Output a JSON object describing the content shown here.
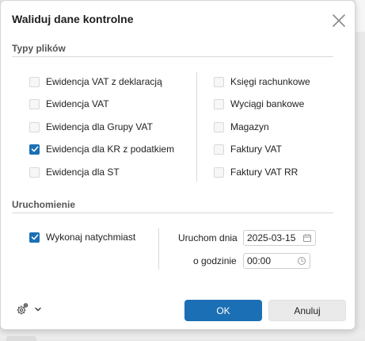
{
  "dialog": {
    "title": "Waliduj dane kontrolne",
    "close_icon": "close-icon"
  },
  "file_types": {
    "section_label": "Typy plików",
    "left": [
      {
        "label": "Ewidencja VAT z deklaracją",
        "checked": false
      },
      {
        "label": "Ewidencja VAT",
        "checked": false
      },
      {
        "label": "Ewidencja dla Grupy VAT",
        "checked": false
      },
      {
        "label": "Ewidencja dla KR z podatkiem",
        "checked": true
      },
      {
        "label": "Ewidencja dla ST",
        "checked": false
      }
    ],
    "right": [
      {
        "label": "Księgi rachunkowe",
        "checked": false
      },
      {
        "label": "Wyciągi bankowe",
        "checked": false
      },
      {
        "label": "Magazyn",
        "checked": false
      },
      {
        "label": "Faktury VAT",
        "checked": false
      },
      {
        "label": "Faktury VAT RR",
        "checked": false
      }
    ]
  },
  "run": {
    "section_label": "Uruchomienie",
    "immediate_label": "Wykonaj natychmiast",
    "immediate_checked": true,
    "date_label": "Uruchom dnia",
    "date_value": "2025-03-15",
    "time_label": "o godzinie",
    "time_value": "00:00"
  },
  "footer": {
    "ok_label": "OK",
    "cancel_label": "Anuluj",
    "settings_icon": "gear-icon"
  },
  "colors": {
    "accent": "#1b6fb5"
  }
}
